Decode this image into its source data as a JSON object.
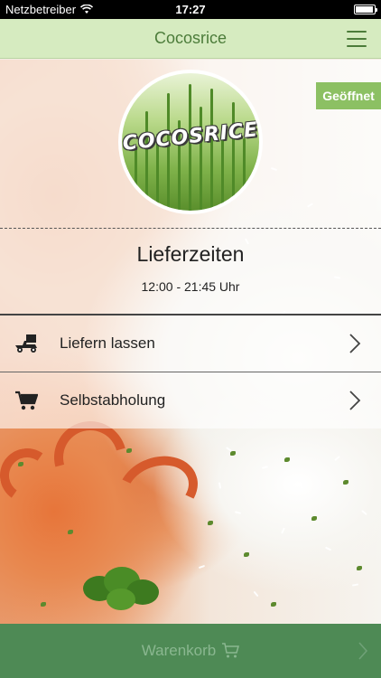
{
  "status_bar": {
    "carrier": "Netzbetreiber",
    "time": "17:27"
  },
  "nav": {
    "title": "Cocosrice"
  },
  "logo": {
    "text": "COCOSRICE"
  },
  "badge": {
    "label": "Geöffnet"
  },
  "delivery": {
    "title": "Lieferzeiten",
    "hours": "12:00 - 21:45 Uhr"
  },
  "options": [
    {
      "label": "Liefern lassen",
      "icon": "delivery-scooter-icon"
    },
    {
      "label": "Selbstabholung",
      "icon": "shopping-cart-icon"
    }
  ],
  "cart": {
    "label": "Warenkorb",
    "icon": "shopping-cart-icon"
  },
  "colors": {
    "nav_background": "#d6ebc0",
    "nav_text": "#4c7c3a",
    "badge": "#8cc063",
    "cart_bar": "#4e8a55",
    "cart_text": "#8ab790"
  }
}
